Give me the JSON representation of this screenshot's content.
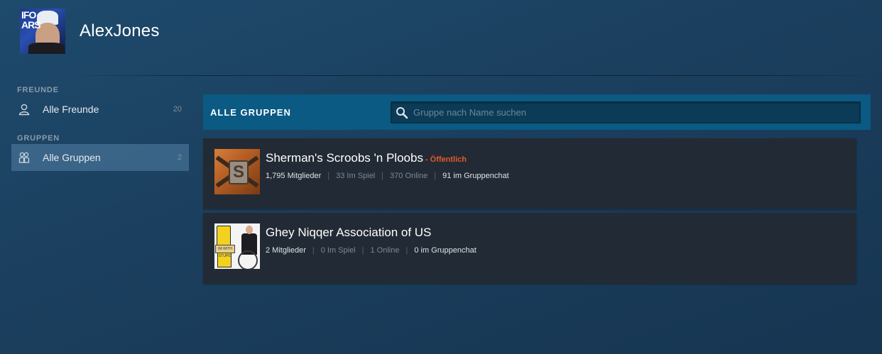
{
  "profile": {
    "name": "AlexJones",
    "avatar_text": "IFO ARS"
  },
  "sidebar": {
    "friends_section": "FREUNDE",
    "friends_item": {
      "label": "Alle Freunde",
      "count": "20",
      "icon": "person-icon"
    },
    "groups_section": "GRUPPEN",
    "groups_item": {
      "label": "Alle Gruppen",
      "count": "2",
      "icon": "group-icon",
      "active": true
    }
  },
  "main": {
    "header_title": "ALLE GRUPPEN",
    "search": {
      "placeholder": "Gruppe nach Name suchen",
      "value": "",
      "icon": "search-icon"
    },
    "groups": [
      {
        "name": "Sherman's Scroobs 'n Ploobs",
        "visibility": "- Öffentlich",
        "members": "1,795 Mitglieder",
        "in_game": "33 Im Spiel",
        "online": "370 Online",
        "in_chat": "91 im Gruppenchat",
        "avatar_letter": "S"
      },
      {
        "name": "Ghey Niqqer Association of US",
        "visibility": "",
        "members": "2 Mitglieder",
        "in_game": "0 Im Spiel",
        "online": "1 Online",
        "in_chat": "0 im Gruppenchat",
        "avatar_sign": "IM WITH STUPID"
      }
    ]
  },
  "colors": {
    "background": "#1b3f5e",
    "header_bar": "#0a5a83",
    "card": "#222b35",
    "visibility_accent": "#e2592b",
    "active_nav": "#4d7a9c"
  }
}
